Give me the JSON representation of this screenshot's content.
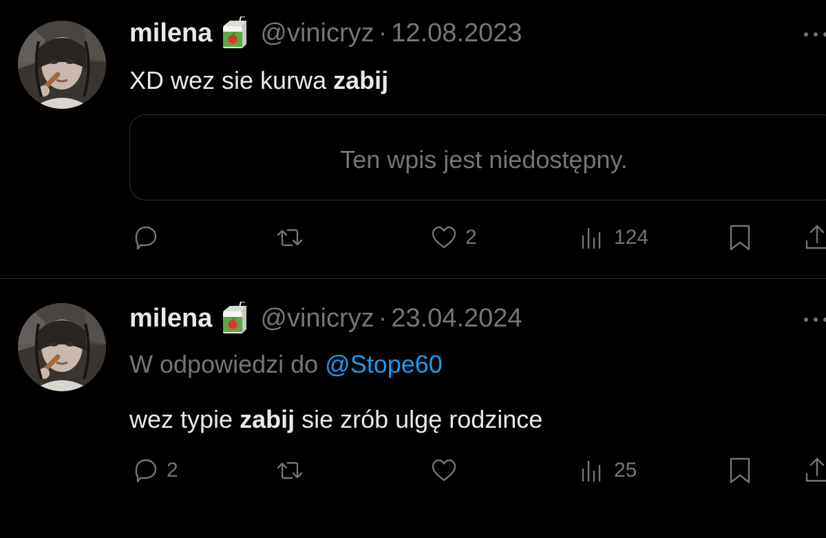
{
  "tweets": [
    {
      "name": "milena",
      "badge_icon": "juice-box-emoji",
      "handle": "@vinicryz",
      "separator": "·",
      "date": "12.08.2023",
      "text_plain": "XD wez sie kurwa ",
      "text_bold": "zabij",
      "quote_text": "Ten wpis jest niedostępny.",
      "counts": {
        "replies": "",
        "retweets": "",
        "likes": "2",
        "views": "124"
      }
    },
    {
      "name": "milena",
      "badge_icon": "juice-box-emoji",
      "handle": "@vinicryz",
      "separator": "·",
      "date": "23.04.2024",
      "replying_prefix": "W odpowiedzi do ",
      "replying_mention": "@Stope60",
      "text_pre": "wez typie ",
      "text_bold": "zabij",
      "text_post": " sie zrób ulgę rodzince",
      "counts": {
        "replies": "2",
        "retweets": "",
        "likes": "",
        "views": "25"
      }
    }
  ],
  "colors": {
    "background": "#000000",
    "text": "#e7e9ea",
    "muted": "#71767b",
    "link": "#1d9bf0",
    "border": "#2f3336"
  },
  "icons": [
    "reply-icon",
    "retweet-icon",
    "like-icon",
    "views-icon",
    "bookmark-icon",
    "share-icon",
    "more-icon"
  ]
}
